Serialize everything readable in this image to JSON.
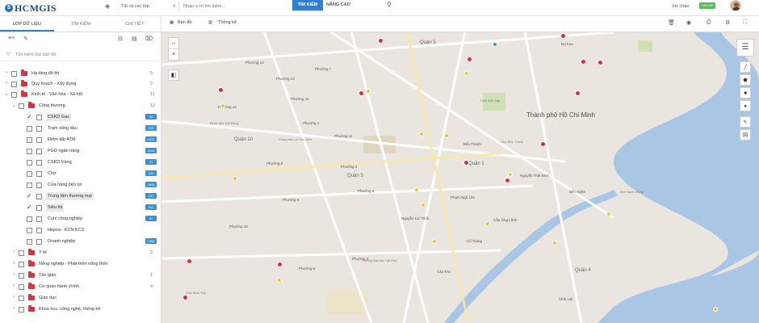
{
  "header": {
    "logo_letter": "$",
    "logo_text": "HCMGIS",
    "layer_select_value": "Tất cả các lớp",
    "search_placeholder": "Nhập vị trí tìm kiếm...",
    "search_button": "TÌM KIẾM",
    "advanced_button": "NÂNG CAO",
    "greeting": "Xin chào",
    "user_badge": "ONLINE"
  },
  "sidebar": {
    "tabs": [
      "LỚP DỮ LIỆU",
      "TÌM KIẾM",
      "CHI TIẾT"
    ],
    "layer_search_placeholder": "Tìm kiếm lớp bản đồ",
    "rows": [
      {
        "label": "Hạ tầng đô thị",
        "count": "5",
        "level": 0
      },
      {
        "label": "Quy hoạch - Xây dựng",
        "count": "2",
        "level": 0
      },
      {
        "label": "Kinh tế - Văn hóa - Xã hội",
        "count": "11",
        "level": 0
      },
      {
        "label": "Công thương",
        "count": "12",
        "level": 1
      },
      {
        "label": "CSKD Gas",
        "badge": "59",
        "level": 2,
        "checked": true
      },
      {
        "label": "Trạm xăng dầu",
        "badge": "325",
        "level": 2
      },
      {
        "label": "Điểm đặt ATM",
        "badge": "1912",
        "level": 2
      },
      {
        "label": "PGD ngân hàng",
        "badge": "1143",
        "level": 2
      },
      {
        "label": "CSKD Vàng",
        "badge": "21",
        "level": 2
      },
      {
        "label": "Chợ",
        "badge": "240",
        "level": 2
      },
      {
        "label": "Cửa hàng tiện lợi",
        "badge": "2808",
        "level": 2
      },
      {
        "label": "Trung tâm thương mại",
        "badge": "101",
        "level": 2,
        "checked": true
      },
      {
        "label": "Siêu thị",
        "badge": "181",
        "level": 2,
        "checked": true
      },
      {
        "label": "Cụm công nghiệp",
        "badge": "37",
        "level": 2
      },
      {
        "label": "Hepza - KCN KCX",
        "level": 2
      },
      {
        "label": "Doanh nghiệp",
        "badge": "7986",
        "level": 2
      },
      {
        "label": "Y tế",
        "count": "2",
        "level": 1
      },
      {
        "label": "Nông nghiệp - Phát triển nông thôn",
        "count": "",
        "level": 1
      },
      {
        "label": "Tôn giáo",
        "count": "1",
        "level": 1
      },
      {
        "label": "Cơ quan hành chính",
        "count": "4",
        "level": 1
      },
      {
        "label": "Giáo dục",
        "count": "",
        "level": 1
      },
      {
        "label": "Khoa học, công nghệ, thống kê",
        "count": "",
        "level": 1
      }
    ]
  },
  "map": {
    "tabs": [
      "Bản đồ",
      "Thống kê"
    ],
    "city_label": "Thành phố Hồ Chí Minh",
    "district_labels": [
      "Quận 10",
      "Quận 3",
      "Quận 4",
      "Quận 5",
      "Phường 14",
      "Phường 13",
      "Phường 12",
      "Phường 15",
      "Phường 7",
      "Phường 9",
      "Phường 6",
      "Phường 2",
      "Phường 3",
      "Phường 4",
      "Phường 11",
      "Phường 8",
      "Phường 10",
      "Phường 1",
      "Bến Thành",
      "Đa Kao",
      "Cầu Ông Lãnh",
      "Nguyễn Cư Trinh",
      "Phạm Ngũ Lão",
      "Cô Giang",
      "Cầu Kho",
      "Nguyễn Thái Bình",
      "Bến Nghé",
      "Vĩnh Hội",
      "Quận 1"
    ],
    "places": [
      "Công viên Lê Văn Tám",
      "Dinh Độc Lập",
      "Chợ Bến Thành",
      "Bệnh viện Nhi Đồng",
      "Chợ Bình Tây",
      "Trường Đại học Sài Gòn",
      "Bến Bạch Đằng"
    ]
  }
}
